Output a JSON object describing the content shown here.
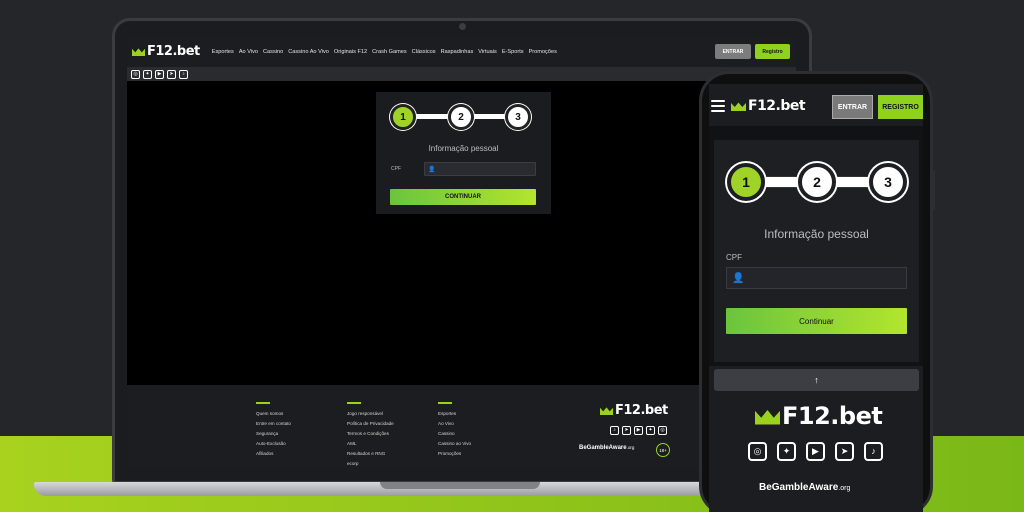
{
  "brand": {
    "logo_text": "F12.bet"
  },
  "colors": {
    "accent": "#9bd21e",
    "button_enter": "#7c7c7c",
    "background": "#25262a"
  },
  "desktop": {
    "nav": {
      "menu": [
        "Esportes",
        "Ao Vivo",
        "Cassino",
        "Cassino Ao Vivo",
        "Originais F12",
        "Crash Games",
        "Clássicos",
        "Raspadinhas",
        "Virtuais",
        "E-Sports",
        "Promoções"
      ],
      "enter_label": "ENTRAR",
      "register_label": "Registro"
    },
    "social_icons": [
      "instagram-icon",
      "twitter-icon",
      "youtube-icon",
      "telegram-icon",
      "tiktok-icon"
    ],
    "form": {
      "steps": [
        "1",
        "2",
        "3"
      ],
      "active_step": 1,
      "title": "Informação pessoal",
      "cpf_label": "CPF",
      "continue_label": "CONTINUAR"
    },
    "footer": {
      "col1": [
        "Quem somos",
        "Entre em contato",
        "Segurança",
        "Auto-Exclusão",
        "Afiliados"
      ],
      "col2": [
        "Jogo responsável",
        "Política de Privacidade",
        "Termos e Condições",
        "AML",
        "Resultados e RNG",
        "ecorp"
      ],
      "col3": [
        "Esportes",
        "Ao Vivo",
        "Cassino",
        "Cassino ao Vivo",
        "Promoções"
      ],
      "gamble_aware": "BeGambleAware",
      "gamble_aware_suffix": ".org",
      "age_badge": "18+"
    }
  },
  "mobile": {
    "header": {
      "enter_label": "ENTRAR",
      "register_label": "REGISTRO"
    },
    "form": {
      "steps": [
        "1",
        "2",
        "3"
      ],
      "active_step": 1,
      "title": "Informação pessoal",
      "cpf_label": "CPF",
      "continue_label": "Continuar"
    },
    "back_to_top": "↑",
    "gamble_aware": "BeGambleAware",
    "gamble_aware_suffix": ".org"
  }
}
